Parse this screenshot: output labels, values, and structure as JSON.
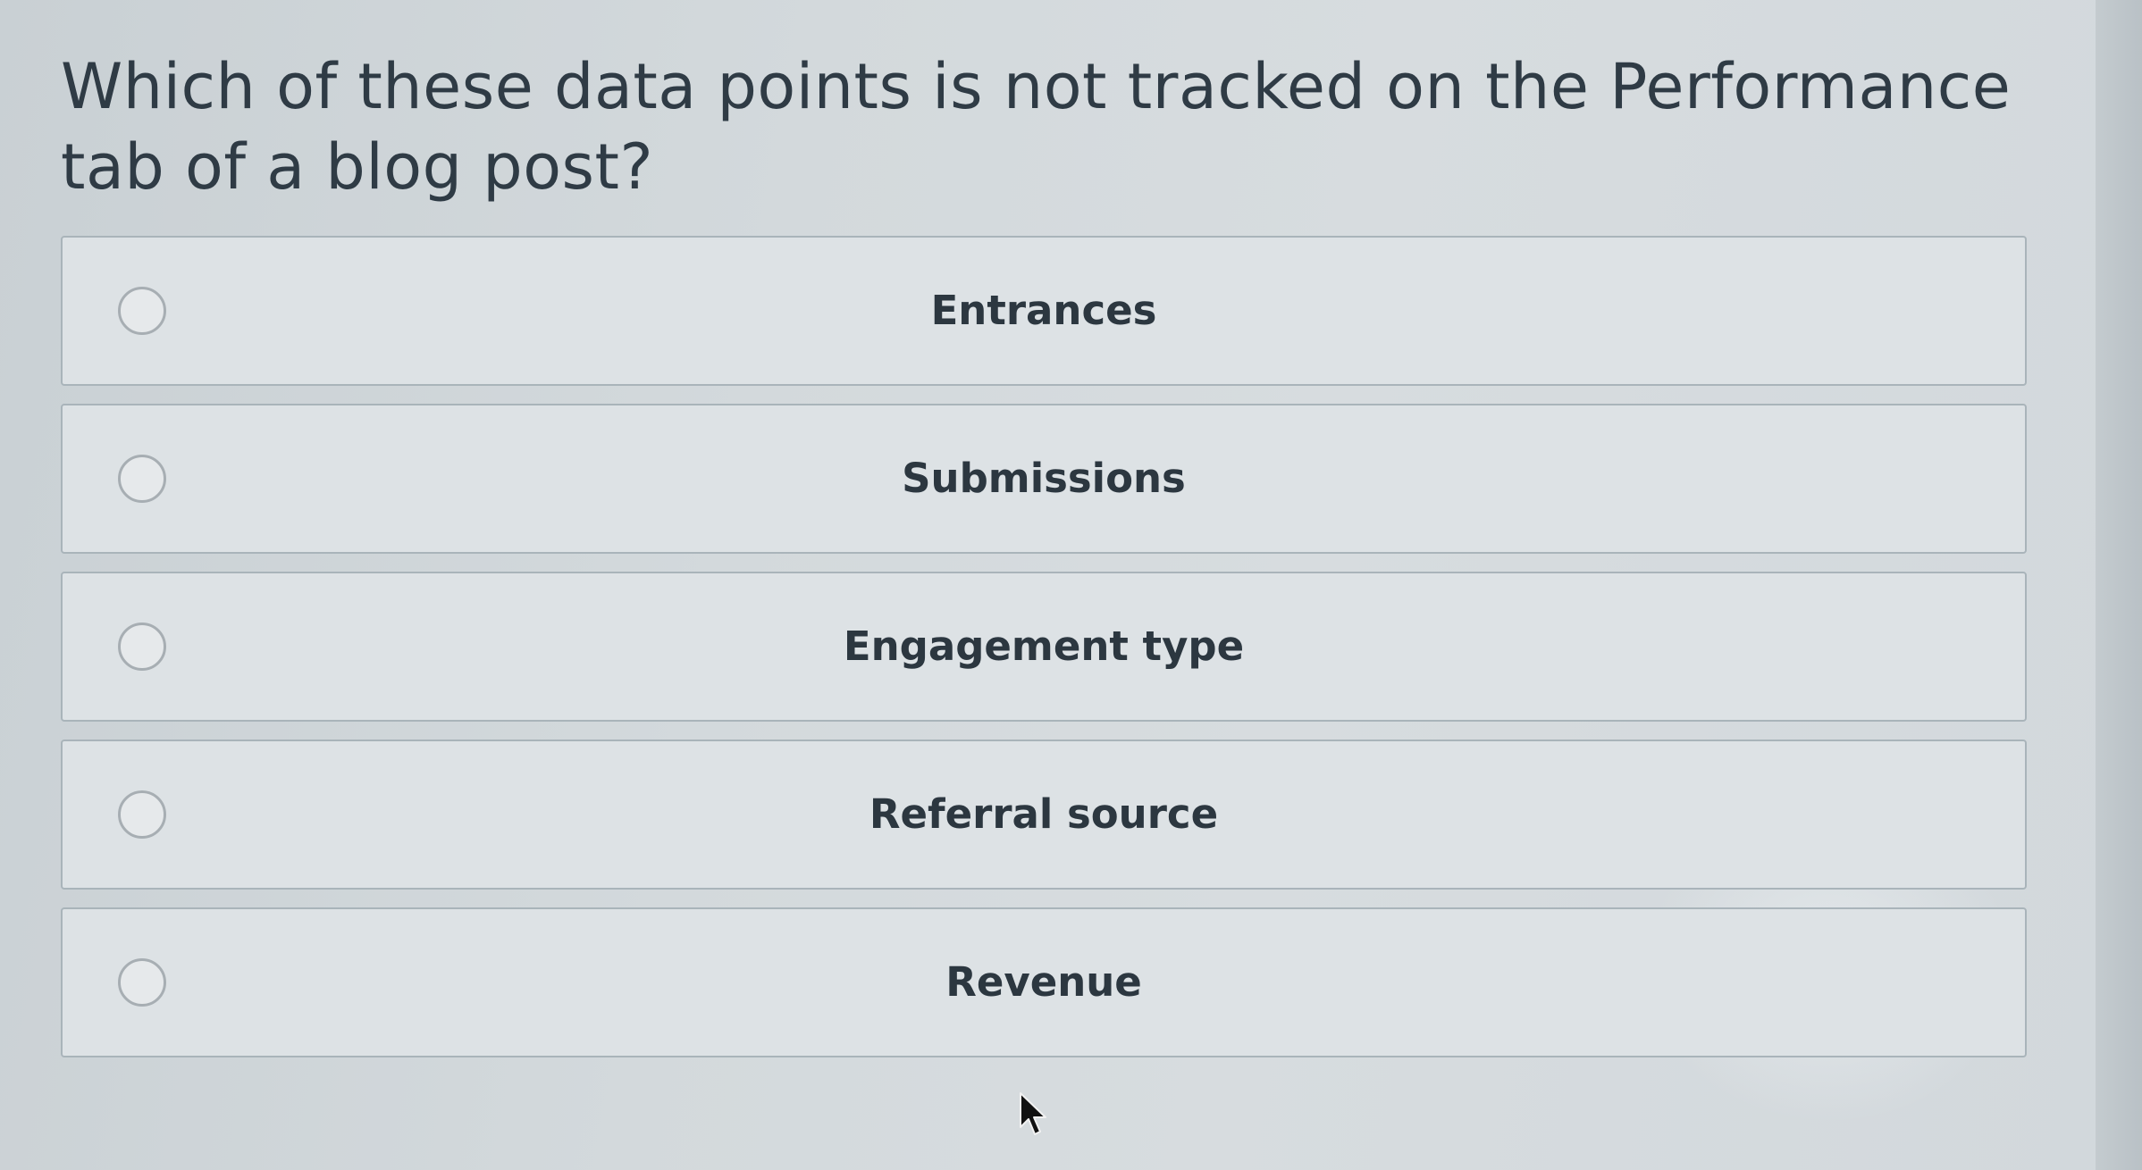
{
  "question": {
    "text": "Which of these data points is not tracked on the Performance tab of a blog post?"
  },
  "options": [
    {
      "label": "Entrances",
      "selected": false
    },
    {
      "label": "Submissions",
      "selected": false
    },
    {
      "label": "Engagement type",
      "selected": false
    },
    {
      "label": "Referral source",
      "selected": false
    },
    {
      "label": "Revenue",
      "selected": false
    }
  ],
  "icons": {
    "radio": "radio-button-icon",
    "cursor": "mouse-pointer-icon"
  },
  "colors": {
    "background": "#d3d9dc",
    "option_fill": "#dde2e5",
    "option_border": "#a9b4ba",
    "text": "#2c3740"
  }
}
